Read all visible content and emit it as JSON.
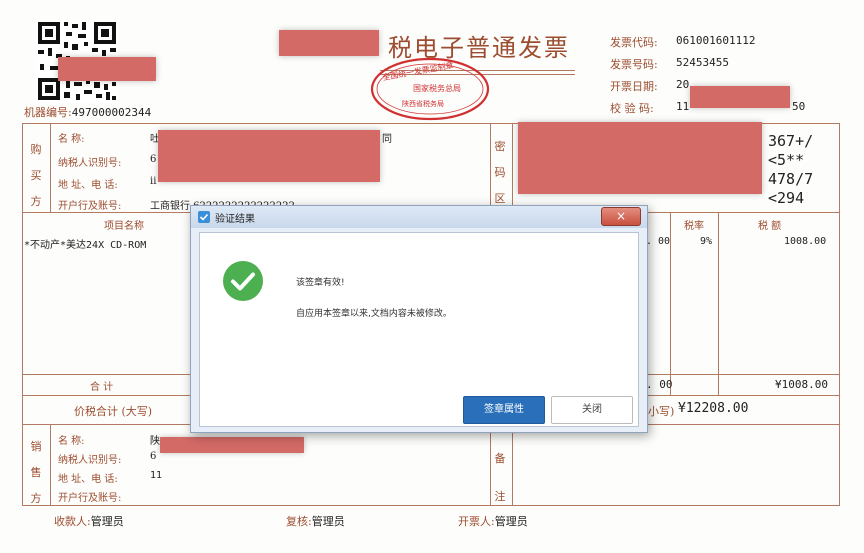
{
  "invoice": {
    "title_visible": "税电子普通发票",
    "machine_no_label": "机器编号:",
    "machine_no": "497000002344",
    "meta": [
      {
        "label": "发票代码:",
        "value": "061001601112"
      },
      {
        "label": "发票号码:",
        "value": "52453455"
      },
      {
        "label": "开票日期:",
        "value": "20"
      },
      {
        "label": "校 验 码:",
        "value": "11"
      }
    ],
    "meta_tail": "50",
    "seal_lines": [
      "全国统一发票监制章",
      "国家税务总局",
      "陕西省税务局"
    ],
    "buyer": {
      "side_label": [
        "购",
        "买",
        "方"
      ],
      "name_label": "名      称:",
      "name_partial": "吐",
      "name_tail": "同",
      "tax_id_label": "纳税人识别号:",
      "tax_id_partial": "6",
      "address_label": "地 址、电 话:",
      "address_partial": "ii",
      "bank_label": "开户行及账号:",
      "bank_value": "工商银行 6222222222222222"
    },
    "cipher": {
      "side_label": [
        "密",
        "码",
        "区"
      ],
      "lines": [
        "367+/",
        "<5**",
        "478/7",
        "<294"
      ]
    },
    "items": {
      "header_name": "项目名称",
      "header_rate": "税率",
      "header_tax": "税 额",
      "row_name": "*不动产*美达24X CD-ROM",
      "row_amount_tail": ". 00",
      "row_rate": "9%",
      "row_tax": "1008.00",
      "total_label": "合       计",
      "total_amount_tail": ". 00",
      "total_tax": "¥1008.00"
    },
    "grand_total": {
      "label": "价税合计 (大写)",
      "small_label_tail": "小写)",
      "value": "¥12208.00"
    },
    "seller": {
      "side_label": [
        "销",
        "售",
        "方"
      ],
      "name_label": "名      称:",
      "name_partial": "陕",
      "tax_id_label": "纳税人识别号:",
      "tax_id_partial": "6",
      "address_label": "地 址、电 话:",
      "address_value": "11",
      "bank_label": "开户行及账号:"
    },
    "remarks_side_label": [
      "备",
      "注"
    ],
    "footer": {
      "payee_label": "收款人:",
      "payee": "管理员",
      "reviewer_label": "复核:",
      "reviewer": "管理员",
      "issuer_label": "开票人:",
      "issuer": "管理员"
    }
  },
  "dialog": {
    "title": "验证结果",
    "message_main": "该签章有效!",
    "message_detail": "自应用本签章以来,文档内容未被修改。",
    "primary_button": "签章属性",
    "secondary_button": "关闭",
    "close_glyph": "×",
    "success_icon": "check-circle-icon",
    "app_icon": "document-verify-icon",
    "colors": {
      "success": "#4caf50",
      "primary": "#2a6fb9",
      "close_btn": "#c9503f"
    }
  }
}
